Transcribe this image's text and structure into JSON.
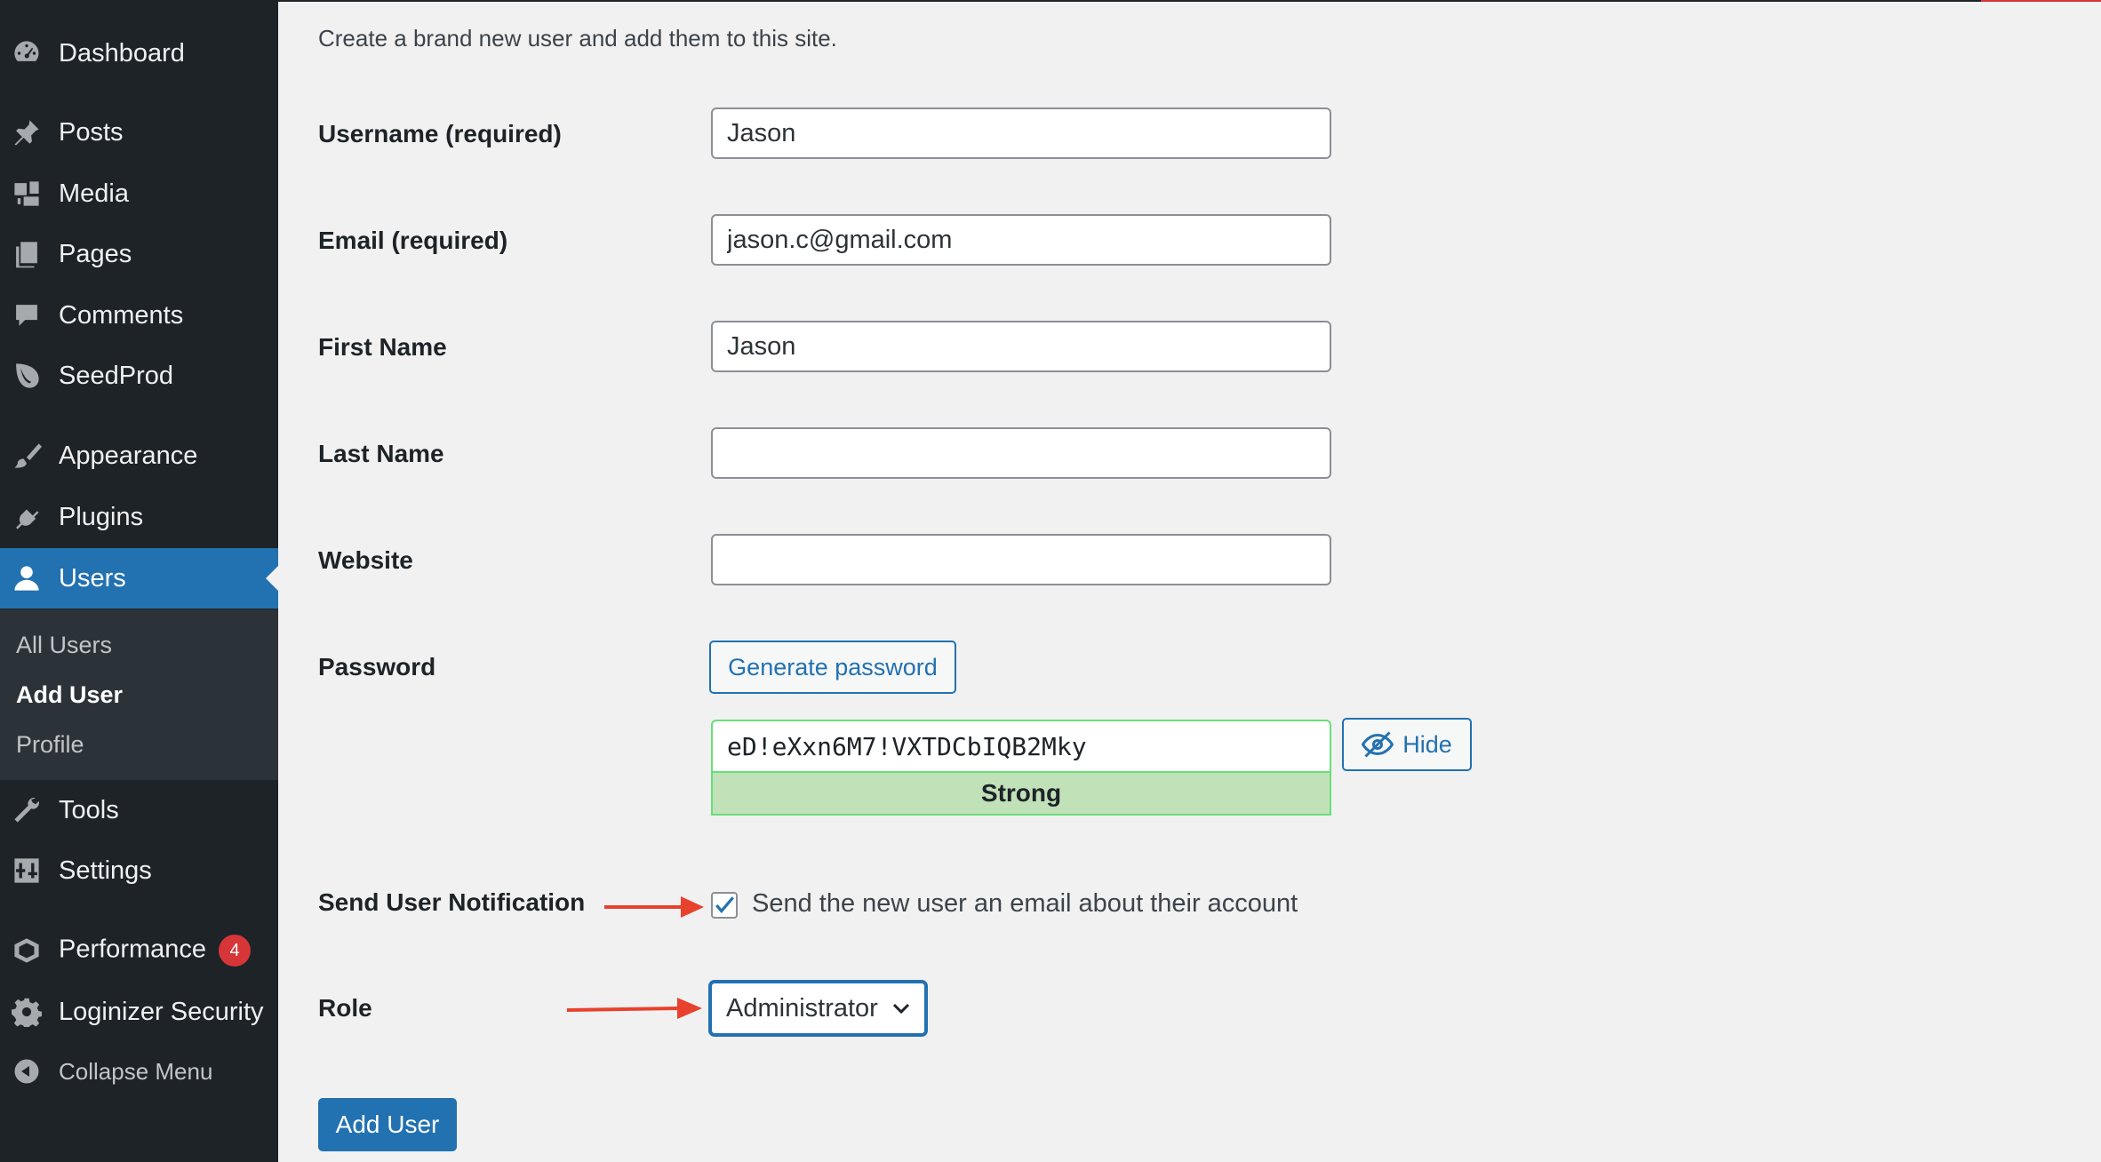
{
  "sidebar": {
    "items": [
      {
        "label": "Dashboard",
        "icon": "dashboard-icon"
      },
      {
        "label": "Posts",
        "icon": "pin-icon"
      },
      {
        "label": "Media",
        "icon": "media-icon"
      },
      {
        "label": "Pages",
        "icon": "pages-icon"
      },
      {
        "label": "Comments",
        "icon": "comment-icon"
      },
      {
        "label": "SeedProd",
        "icon": "seedprod-leaf-icon"
      },
      {
        "label": "Appearance",
        "icon": "brush-icon"
      },
      {
        "label": "Plugins",
        "icon": "plug-icon"
      },
      {
        "label": "Users",
        "icon": "user-icon"
      },
      {
        "label": "Tools",
        "icon": "wrench-icon"
      },
      {
        "label": "Settings",
        "icon": "settings-sliders-icon"
      },
      {
        "label": "Performance",
        "icon": "performance-icon",
        "badge": "4"
      },
      {
        "label": "Loginizer Security",
        "icon": "gear-icon"
      }
    ],
    "submenu": [
      "All Users",
      "Add User",
      "Profile"
    ],
    "collapse_label": "Collapse Menu"
  },
  "form": {
    "intro": "Create a brand new user and add them to this site.",
    "username_label": "Username (required)",
    "username_value": "Jason",
    "email_label": "Email (required)",
    "email_value": "jason.c@gmail.com",
    "firstname_label": "First Name",
    "firstname_value": "Jason",
    "lastname_label": "Last Name",
    "lastname_value": "",
    "website_label": "Website",
    "website_value": "",
    "password_label": "Password",
    "generate_label": "Generate password",
    "password_value": "eD!eXxn6M7!VXTDCbIQB2Mky",
    "hide_label": "Hide",
    "strength_label": "Strong",
    "notification_label": "Send User Notification",
    "notification_text": "Send the new user an email about their account",
    "role_label": "Role",
    "role_value": "Administrator",
    "submit_label": "Add User"
  },
  "colors": {
    "sidebar_bg": "#1d2327",
    "accent": "#2271b1",
    "strength_bg": "#c1e1b9",
    "annotation_arrow": "#e8412c",
    "badge": "#d63638"
  }
}
